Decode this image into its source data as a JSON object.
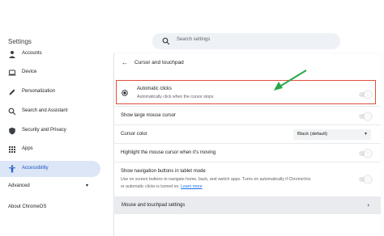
{
  "app": {
    "title": "Settings"
  },
  "search": {
    "placeholder": "Search settings"
  },
  "sidebar": {
    "items": [
      {
        "label": "Accounts",
        "icon": "person-icon"
      },
      {
        "label": "Device",
        "icon": "laptop-icon"
      },
      {
        "label": "Personalization",
        "icon": "pen-icon"
      },
      {
        "label": "Search and Assistant",
        "icon": "search-icon"
      },
      {
        "label": "Security and Privacy",
        "icon": "shield-icon"
      },
      {
        "label": "Apps",
        "icon": "apps-grid-icon"
      },
      {
        "label": "Accessibility",
        "icon": "accessibility-icon",
        "active": true
      }
    ],
    "advanced": "Advanced",
    "about": "About ChromeOS"
  },
  "page": {
    "heading": "Cursor and touchpad",
    "automatic_clicks": {
      "title": "Automatic clicks",
      "subtitle": "Automatically click when the cursor stops",
      "enabled": false
    },
    "large_cursor": {
      "label": "Show large mouse cursor",
      "enabled": false
    },
    "cursor_color": {
      "label": "Cursor color",
      "value": "Black (default)"
    },
    "highlight_cursor": {
      "label": "Highlight the mouse cursor when it's moving",
      "enabled": false
    },
    "tablet_nav": {
      "title": "Show navigation buttons in tablet mode",
      "desc1": "Use on screen buttons to navigate home, back, and switch apps. Turns on automatically if ChromeVox",
      "desc2": "or automatic clicks is turned on.",
      "link": "Learn more",
      "enabled": false
    },
    "mouse_touchpad": {
      "label": "Mouse and touchpad settings"
    }
  },
  "colors": {
    "accent": "#1a73e8",
    "highlight_border": "#e0503a",
    "annotation_arrow": "#2aa846",
    "active_nav_bg": "#dde6f7"
  }
}
